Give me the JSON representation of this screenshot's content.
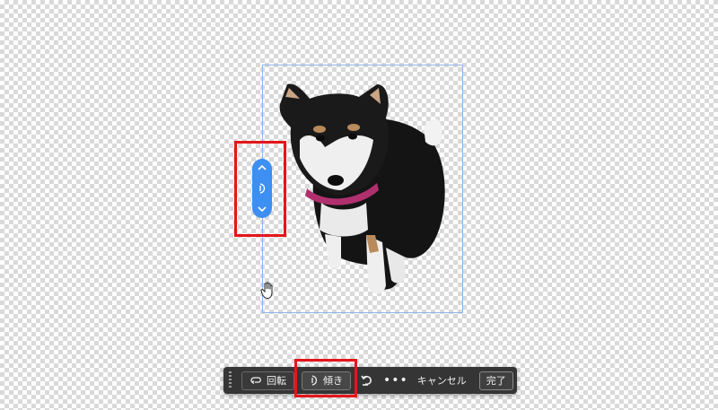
{
  "toolbar": {
    "rotate_label": "回転",
    "tilt_label": "傾き",
    "more_label": "•••",
    "cancel_label": "キャンセル",
    "done_label": "完了"
  },
  "colors": {
    "handle_blue": "#3d8ff2",
    "highlight_red": "#e4161b",
    "bbox_blue": "#8fb4ea",
    "toolbar_bg": "#353535"
  },
  "icons": {
    "rotate": "rotate-icon",
    "tilt": "tilt-icon",
    "reset": "reset-rotate-icon",
    "handle_up": "chevron-up-icon",
    "handle_down": "chevron-down-icon",
    "cursor": "hand-cursor-icon"
  }
}
